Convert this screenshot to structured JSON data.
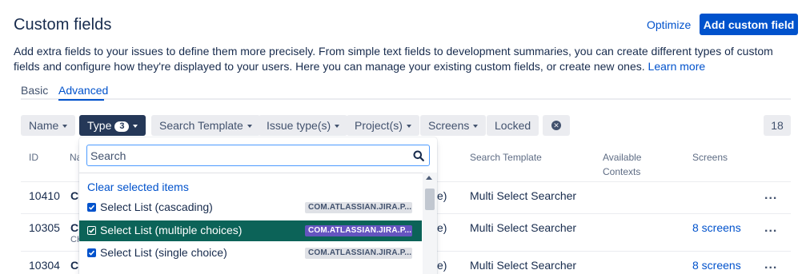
{
  "header": {
    "title": "Custom fields",
    "optimize_label": "Optimize",
    "add_button_label": "Add custom field"
  },
  "description": {
    "text": "Add extra fields to your issues to define them more precisely. From simple text fields to development summaries, you can create different types of custom fields and configure how they're displayed to your users. Here you can manage your existing custom fields, or create new ones.",
    "link_label": "Learn more"
  },
  "tabs": [
    {
      "label": "Basic",
      "active": false
    },
    {
      "label": "Advanced",
      "active": true
    }
  ],
  "filters": {
    "name": "Name",
    "type": "Type",
    "type_count": "3",
    "search_template": "Search Template",
    "issue_types": "Issue type(s)",
    "projects": "Project(s)",
    "screens": "Screens",
    "locked": "Locked",
    "result_count": "18"
  },
  "table": {
    "headers": {
      "id": "ID",
      "name_partial": "Na",
      "search_template": "Search Template",
      "available_contexts_1": "Available",
      "available_contexts_2": "Contexts",
      "screens": "Screens"
    },
    "rows": [
      {
        "id": "10410",
        "name_partial": "Cl",
        "type_tail": "e)",
        "search_template": "Multi Select Searcher",
        "screens": "",
        "actions": "..."
      },
      {
        "id": "10305",
        "name_partial": "Cl",
        "sub_partial": "CH",
        "type_tail": "e)",
        "search_template": "Multi Select Searcher",
        "screens": "8 screens",
        "actions": "..."
      },
      {
        "id": "10304",
        "name_partial": "Cl",
        "type_tail": "e)",
        "search_template": "Multi Select Searcher",
        "screens": "8 screens",
        "actions": "..."
      }
    ]
  },
  "dropdown": {
    "search_placeholder": "Search",
    "clear_label": "Clear selected items",
    "options": [
      {
        "label": "Select List (cascading)",
        "tag": "COM.ATLASSIAN.JIRA.P...",
        "checked": true,
        "highlighted": false
      },
      {
        "label": "Select List (multiple choices)",
        "tag": "COM.ATLASSIAN.JIRA.P...",
        "checked": true,
        "highlighted": true
      },
      {
        "label": "Select List (single choice)",
        "tag": "COM.ATLASSIAN.JIRA.P...",
        "checked": true,
        "highlighted": false
      }
    ]
  },
  "colors": {
    "primary": "#0052cc",
    "filter_active": "#253858",
    "highlight_row": "#0c6358",
    "tag_highlight": "#6554c0"
  }
}
